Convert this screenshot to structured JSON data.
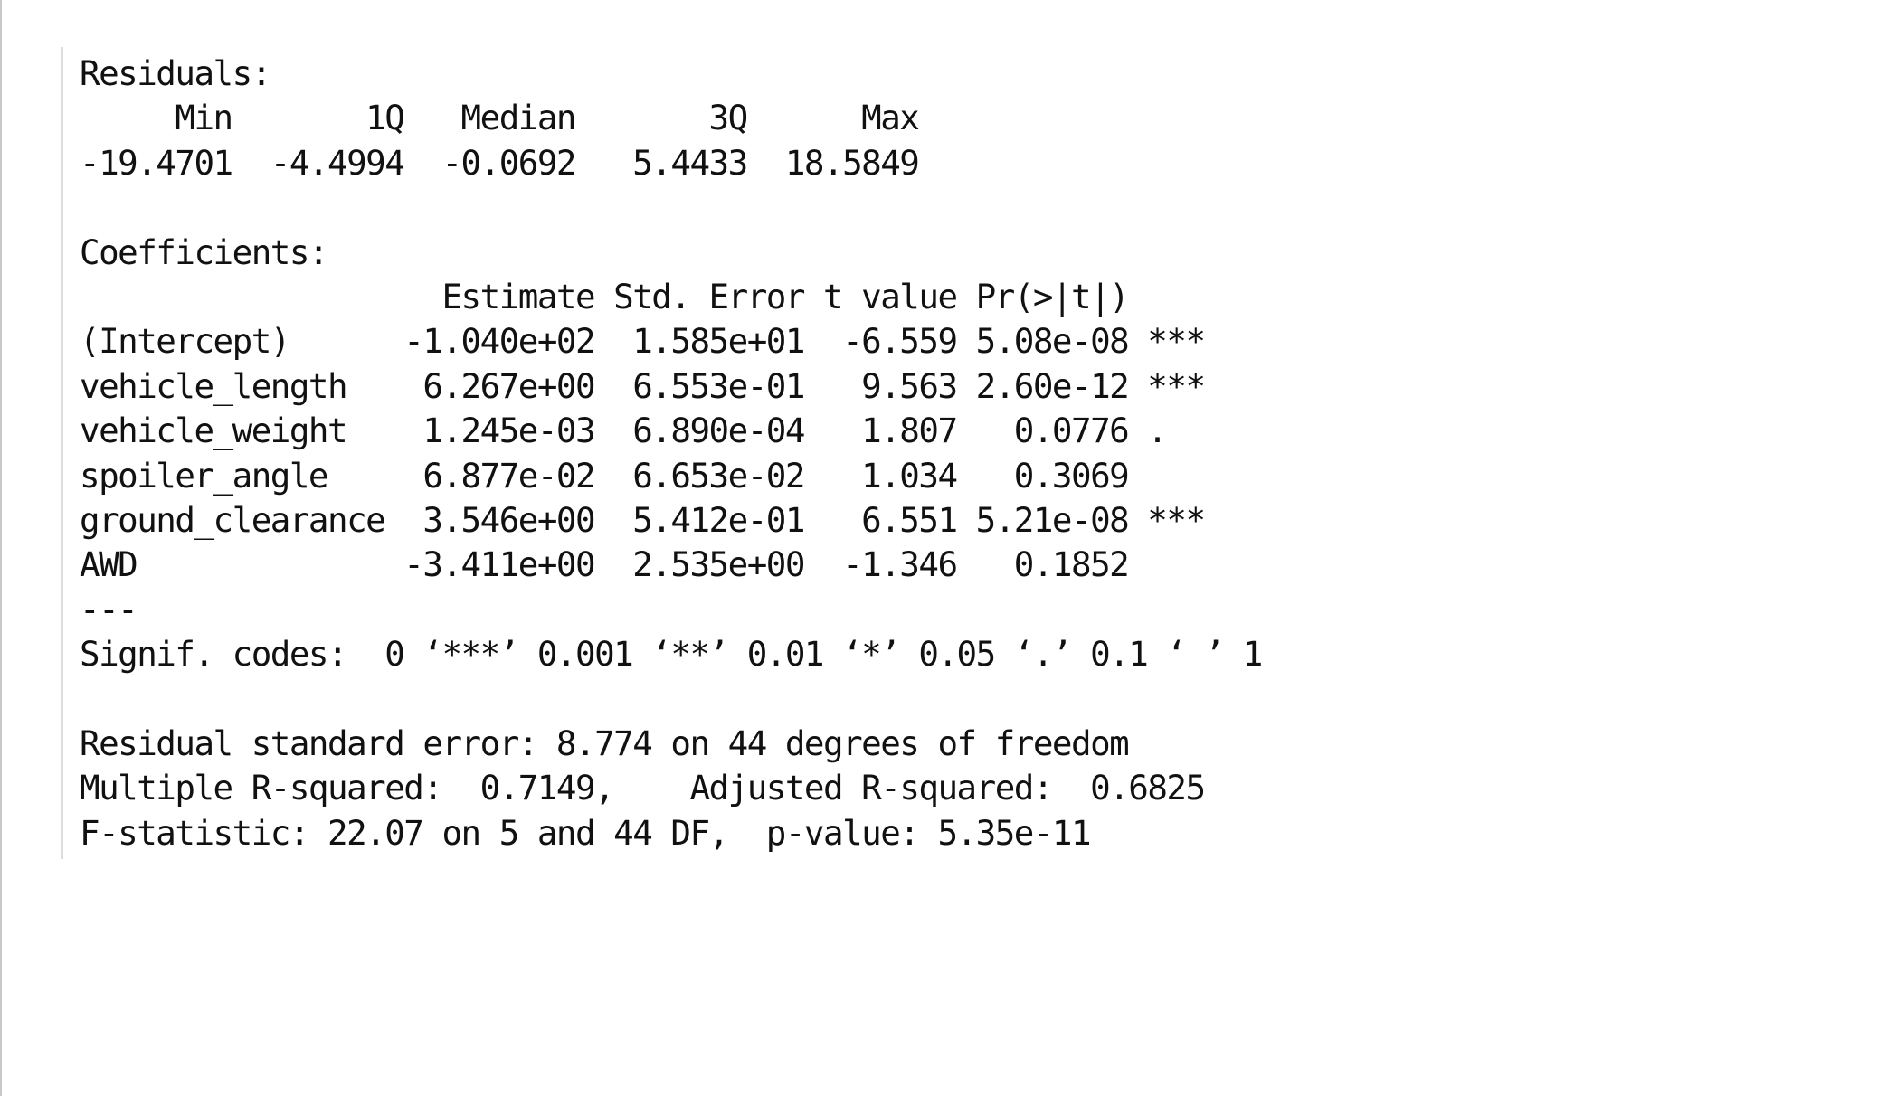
{
  "console": {
    "lines": [
      "Residuals:",
      "     Min       1Q   Median       3Q      Max ",
      "-19.4701  -4.4994  -0.0692   5.4433  18.5849 ",
      "",
      "Coefficients:",
      "                   Estimate Std. Error t value Pr(>|t|)    ",
      "(Intercept)      -1.040e+02  1.585e+01  -6.559 5.08e-08 ***",
      "vehicle_length    6.267e+00  6.553e-01   9.563 2.60e-12 ***",
      "vehicle_weight    1.245e-03  6.890e-04   1.807   0.0776 .  ",
      "spoiler_angle     6.877e-02  6.653e-02   1.034   0.3069    ",
      "ground_clearance  3.546e+00  5.412e-01   6.551 5.21e-08 ***",
      "AWD              -3.411e+00  2.535e+00  -1.346   0.1852    ",
      "---",
      "Signif. codes:  0 ‘***’ 0.001 ‘**’ 0.01 ‘*’ 0.05 ‘.’ 0.1 ‘ ’ 1",
      "",
      "Residual standard error: 8.774 on 44 degrees of freedom",
      "Multiple R-squared:  0.7149,\tAdjusted R-squared:  0.6825 ",
      "F-statistic: 22.07 on 5 and 44 DF,  p-value: 5.35e-11"
    ]
  }
}
